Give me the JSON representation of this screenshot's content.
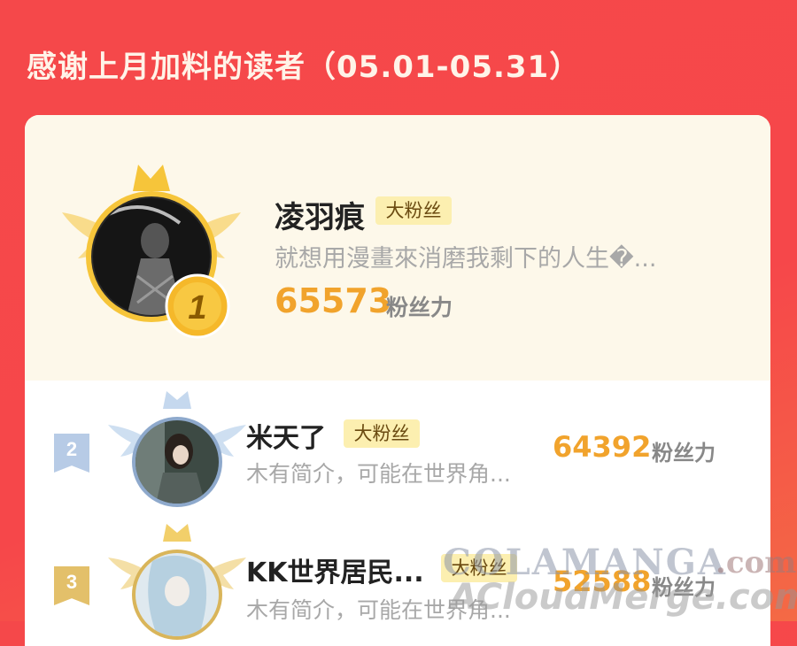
{
  "header": {
    "title": "感谢上月加料的读者（05.01-05.31）"
  },
  "colors": {
    "background": "#f5484a",
    "score": "#f1a32c",
    "badge_bg": "#fcefb0",
    "gold": "#f6c53a",
    "silver": "#a9c3e0",
    "bronze": "#e6c07a"
  },
  "readers": [
    {
      "rank": "1",
      "name": "凌羽痕",
      "badge": "大粉丝",
      "bio": "就想用漫畫來消磨我剩下的人生�...",
      "score": "65573",
      "unit": "粉丝力"
    },
    {
      "rank": "2",
      "name": "米天了",
      "badge": "大粉丝",
      "bio": "木有简介，可能在世界角...",
      "score": "64392",
      "unit": "粉丝力"
    },
    {
      "rank": "3",
      "name": "KK世界居民...",
      "badge": "大粉丝",
      "bio": "木有简介，可能在世界角...",
      "score": "52588",
      "unit": "粉丝力"
    }
  ],
  "watermark": {
    "line1": "COLAMANGA",
    "line1_suffix": ".com",
    "line2": "ACloudMerge.com"
  }
}
